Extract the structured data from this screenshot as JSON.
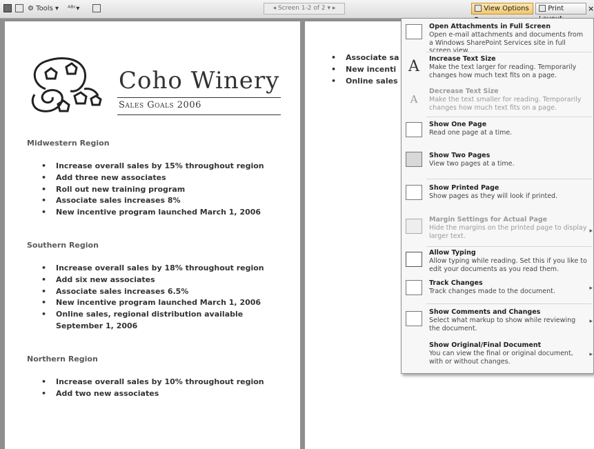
{
  "toolbar": {
    "tools_label": "Tools",
    "screen_label": "Screen 1-2 of 2",
    "view_options_label": "View Options",
    "print_layout_label": "Print Layout",
    "close_glyph": "×"
  },
  "document": {
    "brand_title": "Coho Winery",
    "brand_subtitle": "Sales Goals 2006",
    "regions": [
      {
        "name": "Midwestern Region",
        "bullets": [
          "Increase overall sales by 15% throughout region",
          "Add three new associates",
          "Roll out new training program",
          "Associate sales increases 8%",
          "New incentive program launched March 1, 2006"
        ]
      },
      {
        "name": "Southern Region",
        "bullets": [
          "Increase overall sales by 18% throughout region",
          "Add six new associates",
          "Associate sales increases 6.5%",
          "New incentive program launched March 1, 2006",
          "Online sales, regional distribution available September 1, 2006"
        ]
      },
      {
        "name": "Northern Region",
        "bullets": [
          "Increase overall sales by 10% throughout region",
          "Add two new associates"
        ]
      }
    ],
    "right_page_bullets": [
      "Associate sa",
      "New incenti",
      "Online sales"
    ]
  },
  "view_menu": {
    "items": [
      {
        "title": "Open Attachments in Full Screen",
        "desc": "Open e-mail attachments and documents from a Windows SharePoint Services site in full screen view."
      },
      {
        "title": "Increase Text Size",
        "desc": "Make the text larger for reading. Temporarily changes how much text fits on a page."
      },
      {
        "title": "Decrease Text Size",
        "desc": "Make the text smaller for reading. Temporarily changes how much text fits on a page."
      },
      {
        "title": "Show One Page",
        "desc": "Read one page at a time."
      },
      {
        "title": "Show Two Pages",
        "desc": "View two pages at a time."
      },
      {
        "title": "Show Printed Page",
        "desc": "Show pages as they will look if printed."
      },
      {
        "title": "Margin Settings for Actual Page",
        "desc": "Hide the margins on the printed page to display larger text."
      },
      {
        "title": "Allow Typing",
        "desc": "Allow typing while reading. Set this if you like to edit your documents as you read them."
      },
      {
        "title": "Track Changes",
        "desc": "Track changes made to the document."
      },
      {
        "title": "Show Comments and Changes",
        "desc": "Select what markup to show while reviewing the document."
      },
      {
        "title": "Show Original/Final Document",
        "desc": "You can view the final or original document, with or without changes."
      }
    ]
  },
  "icons": {
    "save": "save-icon",
    "print": "print-icon",
    "tools": "tools-icon",
    "increase_text": "A",
    "decrease_text": "A"
  }
}
